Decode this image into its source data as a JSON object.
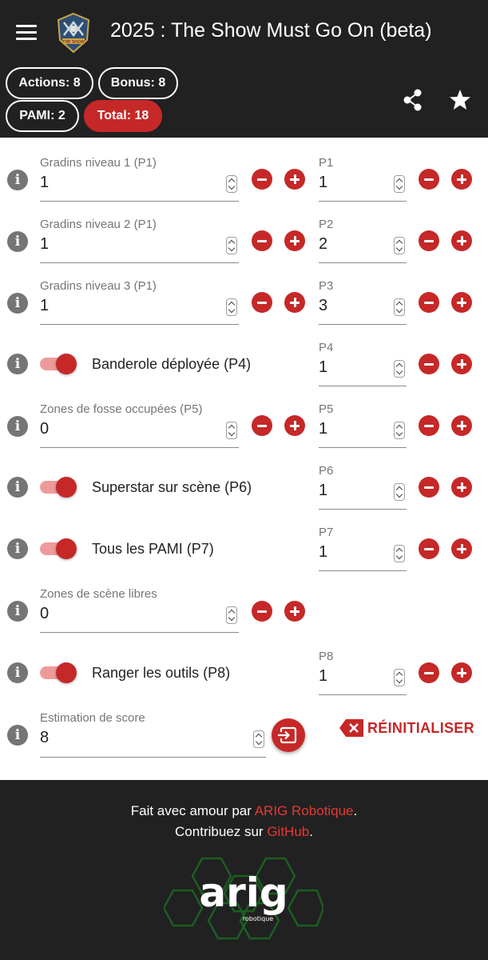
{
  "app": {
    "title": "2025 : The Show Must Go On (beta)",
    "logo_text": "THE SHOW"
  },
  "chips": {
    "actions": "Actions: 8",
    "bonus": "Bonus: 8",
    "pami": "PAMI: 2",
    "total": "Total: 18"
  },
  "rows": [
    {
      "left_label": "Gradins niveau 1 (P1)",
      "left_value": "1",
      "right_label": "P1",
      "right_value": "1"
    },
    {
      "left_label": "Gradins niveau 2 (P1)",
      "left_value": "1",
      "right_label": "P2",
      "right_value": "2"
    },
    {
      "left_label": "Gradins niveau 3 (P1)",
      "left_value": "1",
      "right_label": "P3",
      "right_value": "3"
    },
    {
      "toggle_label": "Banderole déployée (P4)",
      "toggle_on": true,
      "right_label": "P4",
      "right_value": "1"
    },
    {
      "left_label": "Zones de fosse occupées (P5)",
      "left_value": "0",
      "right_label": "P5",
      "right_value": "1"
    },
    {
      "toggle_label": "Superstar sur scène (P6)",
      "toggle_on": true,
      "right_label": "P6",
      "right_value": "1"
    },
    {
      "toggle_label": "Tous les PAMI (P7)",
      "toggle_on": true,
      "right_label": "P7",
      "right_value": "1"
    },
    {
      "left_label": "Zones de scène libres",
      "left_value": "0"
    },
    {
      "toggle_label": "Ranger les outils (P8)",
      "toggle_on": true,
      "right_label": "P8",
      "right_value": "1"
    }
  ],
  "estimate": {
    "label": "Estimation de score",
    "value": "8",
    "reset_label": "RÉINITIALISER"
  },
  "footer": {
    "line1_prefix": "Fait avec amour par ",
    "line1_link": "ARIG Robotique",
    "line1_suffix": ".",
    "line2_prefix": "Contribuez sur ",
    "line2_link": "GitHub",
    "line2_suffix": ".",
    "logo_text": "arig",
    "logo_subtext": "robotique"
  },
  "colors": {
    "accent": "#c62828",
    "bar": "#212121",
    "toggle_track": "#ef9a9a"
  }
}
